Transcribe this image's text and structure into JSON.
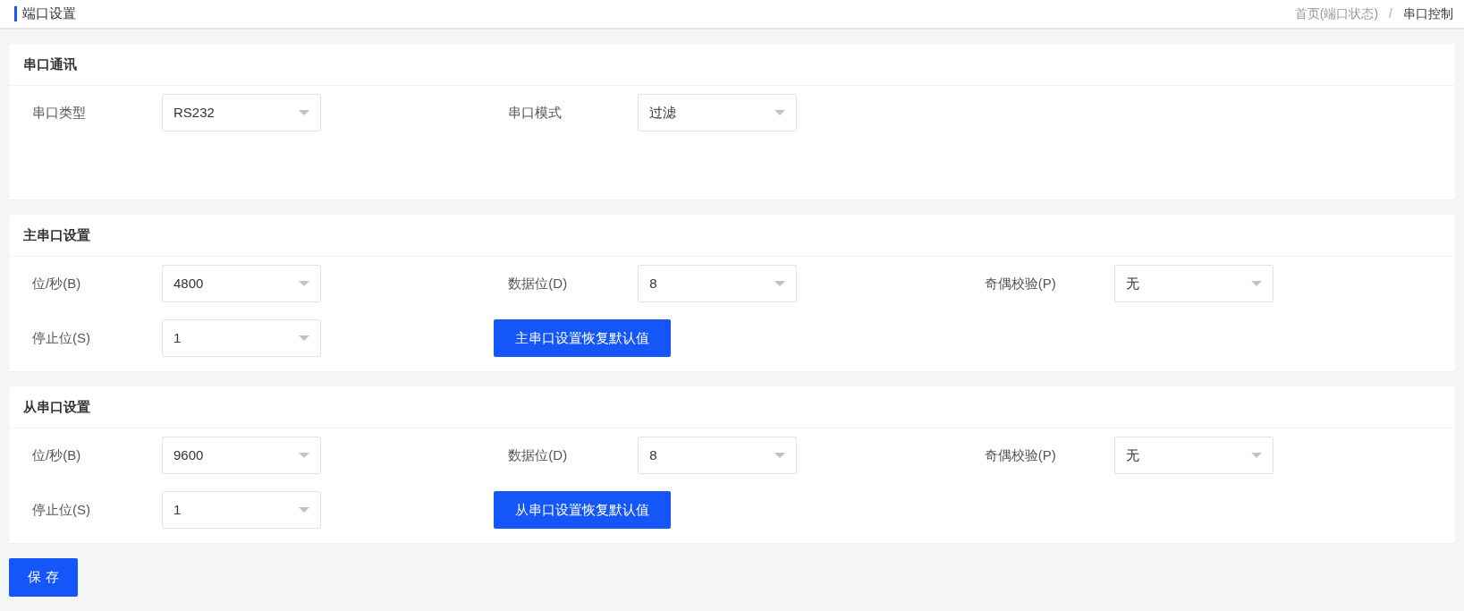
{
  "header": {
    "title": "端口设置",
    "breadcrumb": [
      {
        "label": "首页(端口状态)",
        "current": false
      },
      {
        "label": "串口控制",
        "current": true
      }
    ],
    "separator": "/"
  },
  "sections": [
    {
      "title": "串口通讯",
      "fields": [
        {
          "kind": "select",
          "label": "串口类型",
          "value": "RS232"
        },
        {
          "kind": "select",
          "label": "串口模式",
          "value": "过滤"
        }
      ]
    },
    {
      "title": "主串口设置",
      "fields": [
        {
          "kind": "select",
          "label": "位/秒(B)",
          "value": "4800"
        },
        {
          "kind": "select",
          "label": "数据位(D)",
          "value": "8"
        },
        {
          "kind": "select",
          "label": "奇偶校验(P)",
          "value": "无"
        },
        {
          "kind": "select",
          "label": "停止位(S)",
          "value": "1"
        },
        {
          "kind": "button",
          "label": "主串口设置恢复默认值"
        }
      ]
    },
    {
      "title": "从串口设置",
      "fields": [
        {
          "kind": "select",
          "label": "位/秒(B)",
          "value": "9600"
        },
        {
          "kind": "select",
          "label": "数据位(D)",
          "value": "8"
        },
        {
          "kind": "select",
          "label": "奇偶校验(P)",
          "value": "无"
        },
        {
          "kind": "select",
          "label": "停止位(S)",
          "value": "1"
        },
        {
          "kind": "button",
          "label": "从串口设置恢复默认值"
        }
      ]
    }
  ],
  "save_button": "保 存"
}
